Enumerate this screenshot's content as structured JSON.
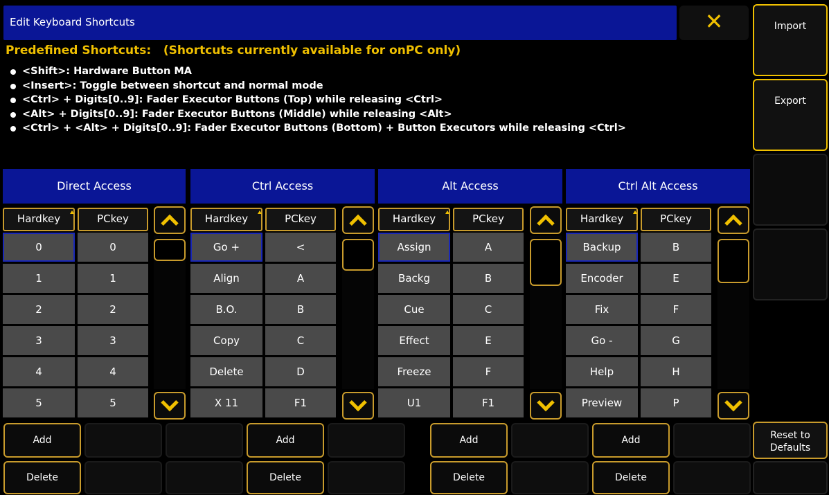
{
  "window": {
    "title": "Edit Keyboard Shortcuts",
    "close_label": "✕"
  },
  "side": {
    "import": "Import",
    "export": "Export",
    "reset": "Reset to Defaults"
  },
  "info": {
    "heading": "Predefined Shortcuts:   (Shortcuts currently available for onPC only)",
    "items": [
      "<Shift>: Hardware Button MA",
      "<Insert>: Toggle between shortcut and normal mode",
      "<Ctrl> + Digits[0..9]: Fader Executor Buttons (Top) while releasing <Ctrl>",
      "<Alt> + Digits[0..9]: Fader Executor Buttons (Middle) while releasing <Alt>",
      "<Ctrl> + <Alt> + Digits[0..9]: Fader Executor Buttons (Bottom) + Button Executors while releasing <Ctrl>"
    ]
  },
  "columns": {
    "hardkey": "Hardkey",
    "pckey": "PCkey"
  },
  "sections": [
    {
      "title": "Direct Access",
      "rows": [
        [
          "0",
          "0"
        ],
        [
          "1",
          "1"
        ],
        [
          "2",
          "2"
        ],
        [
          "3",
          "3"
        ],
        [
          "4",
          "4"
        ],
        [
          "5",
          "5"
        ]
      ]
    },
    {
      "title": "Ctrl Access",
      "rows": [
        [
          "Go +",
          "<"
        ],
        [
          "Align",
          "A"
        ],
        [
          "B.O.",
          "B"
        ],
        [
          "Copy",
          "C"
        ],
        [
          "Delete",
          "D"
        ],
        [
          "X 11",
          "F1"
        ]
      ]
    },
    {
      "title": "Alt Access",
      "rows": [
        [
          "Assign",
          "A"
        ],
        [
          "Backg",
          "B"
        ],
        [
          "Cue",
          "C"
        ],
        [
          "Effect",
          "E"
        ],
        [
          "Freeze",
          "F"
        ],
        [
          "U1",
          "F1"
        ]
      ]
    },
    {
      "title": "Ctrl Alt Access",
      "rows": [
        [
          "Backup",
          "B"
        ],
        [
          "Encoder",
          "E"
        ],
        [
          "Fix",
          "F"
        ],
        [
          "Go -",
          "G"
        ],
        [
          "Help",
          "H"
        ],
        [
          "Preview",
          "P"
        ]
      ]
    }
  ],
  "buttons": {
    "add": "Add",
    "delete": "Delete"
  },
  "colors": {
    "accent": "#f0c000",
    "titlebar": "#0a1696",
    "cell": "#4a4a4a"
  }
}
